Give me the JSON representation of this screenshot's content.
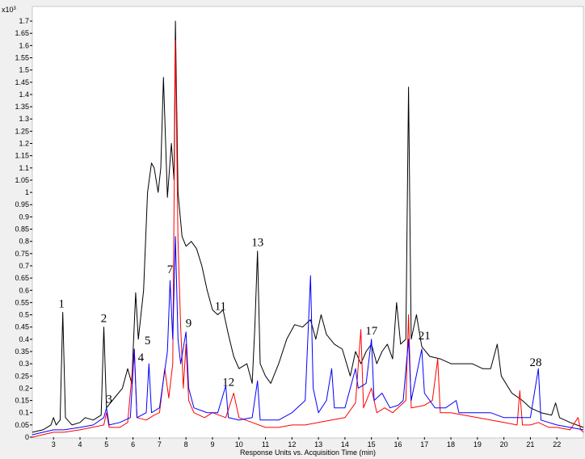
{
  "chart_data": {
    "type": "line",
    "title": "",
    "xlabel": "Response Units vs. Acquisition Time (min)",
    "ylabel": "",
    "y_multiplier": "x10",
    "y_multiplier_exp": "3",
    "xlim": [
      2.2,
      23.0
    ],
    "ylim": [
      0,
      1.72
    ],
    "x_ticks": [
      3,
      4,
      5,
      6,
      7,
      8,
      9,
      10,
      11,
      12,
      13,
      14,
      15,
      16,
      17,
      18,
      19,
      20,
      21,
      22
    ],
    "y_ticks": [
      0,
      0.05,
      0.1,
      0.15,
      0.2,
      0.25,
      0.3,
      0.35,
      0.4,
      0.45,
      0.5,
      0.55,
      0.6,
      0.65,
      0.7,
      0.75,
      0.8,
      0.85,
      0.9,
      0.95,
      1,
      1.05,
      1.1,
      1.15,
      1.2,
      1.25,
      1.3,
      1.35,
      1.4,
      1.45,
      1.5,
      1.55,
      1.6,
      1.65,
      1.7
    ],
    "grid": false,
    "series": [
      {
        "color": "#000000",
        "points": [
          [
            2.2,
            0.02
          ],
          [
            2.6,
            0.03
          ],
          [
            2.9,
            0.05
          ],
          [
            3.0,
            0.08
          ],
          [
            3.1,
            0.05
          ],
          [
            3.25,
            0.07
          ],
          [
            3.35,
            0.51
          ],
          [
            3.45,
            0.08
          ],
          [
            3.7,
            0.05
          ],
          [
            4.0,
            0.06
          ],
          [
            4.2,
            0.08
          ],
          [
            4.5,
            0.07
          ],
          [
            4.8,
            0.09
          ],
          [
            4.9,
            0.45
          ],
          [
            5.0,
            0.12
          ],
          [
            5.3,
            0.16
          ],
          [
            5.6,
            0.2
          ],
          [
            5.8,
            0.28
          ],
          [
            5.95,
            0.22
          ],
          [
            6.1,
            0.59
          ],
          [
            6.2,
            0.4
          ],
          [
            6.4,
            0.6
          ],
          [
            6.55,
            1.0
          ],
          [
            6.7,
            1.12
          ],
          [
            6.8,
            1.1
          ],
          [
            6.95,
            1.0
          ],
          [
            7.05,
            1.1
          ],
          [
            7.15,
            1.47
          ],
          [
            7.3,
            0.98
          ],
          [
            7.45,
            1.2
          ],
          [
            7.55,
            1.05
          ],
          [
            7.6,
            1.7
          ],
          [
            7.7,
            1.0
          ],
          [
            7.85,
            0.82
          ],
          [
            8.0,
            0.78
          ],
          [
            8.2,
            0.8
          ],
          [
            8.4,
            0.77
          ],
          [
            8.6,
            0.7
          ],
          [
            8.8,
            0.6
          ],
          [
            9.0,
            0.52
          ],
          [
            9.2,
            0.5
          ],
          [
            9.4,
            0.52
          ],
          [
            9.6,
            0.42
          ],
          [
            9.8,
            0.33
          ],
          [
            10.0,
            0.28
          ],
          [
            10.3,
            0.3
          ],
          [
            10.5,
            0.22
          ],
          [
            10.6,
            0.45
          ],
          [
            10.7,
            0.76
          ],
          [
            10.8,
            0.3
          ],
          [
            11.0,
            0.25
          ],
          [
            11.2,
            0.22
          ],
          [
            11.5,
            0.3
          ],
          [
            11.8,
            0.4
          ],
          [
            12.1,
            0.46
          ],
          [
            12.4,
            0.45
          ],
          [
            12.7,
            0.48
          ],
          [
            12.9,
            0.4
          ],
          [
            13.1,
            0.5
          ],
          [
            13.3,
            0.42
          ],
          [
            13.6,
            0.38
          ],
          [
            13.9,
            0.36
          ],
          [
            14.2,
            0.25
          ],
          [
            14.4,
            0.35
          ],
          [
            14.6,
            0.3
          ],
          [
            14.8,
            0.35
          ],
          [
            15.0,
            0.38
          ],
          [
            15.2,
            0.3
          ],
          [
            15.4,
            0.35
          ],
          [
            15.6,
            0.38
          ],
          [
            15.8,
            0.32
          ],
          [
            15.95,
            0.55
          ],
          [
            16.1,
            0.38
          ],
          [
            16.3,
            0.4
          ],
          [
            16.4,
            1.43
          ],
          [
            16.5,
            0.4
          ],
          [
            16.7,
            0.5
          ],
          [
            16.9,
            0.37
          ],
          [
            17.2,
            0.33
          ],
          [
            17.6,
            0.32
          ],
          [
            18.0,
            0.3
          ],
          [
            18.4,
            0.3
          ],
          [
            18.8,
            0.3
          ],
          [
            19.2,
            0.28
          ],
          [
            19.5,
            0.28
          ],
          [
            19.75,
            0.38
          ],
          [
            19.9,
            0.25
          ],
          [
            20.3,
            0.18
          ],
          [
            20.7,
            0.15
          ],
          [
            21.0,
            0.12
          ],
          [
            21.4,
            0.1
          ],
          [
            21.8,
            0.09
          ],
          [
            21.95,
            0.14
          ],
          [
            22.1,
            0.08
          ],
          [
            22.5,
            0.06
          ],
          [
            23.0,
            0.04
          ]
        ]
      },
      {
        "color": "#ff0000",
        "points": [
          [
            2.2,
            0.0
          ],
          [
            3.0,
            0.02
          ],
          [
            3.4,
            0.02
          ],
          [
            4.0,
            0.03
          ],
          [
            4.9,
            0.05
          ],
          [
            5.0,
            0.1
          ],
          [
            5.1,
            0.04
          ],
          [
            5.5,
            0.04
          ],
          [
            5.8,
            0.06
          ],
          [
            6.05,
            0.36
          ],
          [
            6.15,
            0.08
          ],
          [
            6.5,
            0.07
          ],
          [
            6.8,
            0.09
          ],
          [
            7.0,
            0.1
          ],
          [
            7.2,
            0.28
          ],
          [
            7.35,
            0.16
          ],
          [
            7.5,
            0.3
          ],
          [
            7.6,
            1.62
          ],
          [
            7.7,
            0.8
          ],
          [
            7.8,
            0.45
          ],
          [
            7.9,
            0.2
          ],
          [
            8.0,
            0.38
          ],
          [
            8.1,
            0.15
          ],
          [
            8.3,
            0.1
          ],
          [
            8.7,
            0.08
          ],
          [
            9.0,
            0.1
          ],
          [
            9.5,
            0.08
          ],
          [
            9.8,
            0.18
          ],
          [
            10.0,
            0.08
          ],
          [
            10.5,
            0.06
          ],
          [
            11.0,
            0.04
          ],
          [
            11.5,
            0.04
          ],
          [
            12.0,
            0.05
          ],
          [
            12.5,
            0.05
          ],
          [
            13.0,
            0.06
          ],
          [
            13.5,
            0.07
          ],
          [
            14.0,
            0.08
          ],
          [
            14.4,
            0.14
          ],
          [
            14.6,
            0.44
          ],
          [
            14.7,
            0.12
          ],
          [
            15.0,
            0.2
          ],
          [
            15.2,
            0.1
          ],
          [
            15.5,
            0.12
          ],
          [
            15.8,
            0.1
          ],
          [
            16.0,
            0.12
          ],
          [
            16.3,
            0.15
          ],
          [
            16.4,
            0.5
          ],
          [
            16.5,
            0.12
          ],
          [
            17.0,
            0.13
          ],
          [
            17.3,
            0.15
          ],
          [
            17.5,
            0.32
          ],
          [
            17.6,
            0.1
          ],
          [
            18.0,
            0.1
          ],
          [
            18.5,
            0.09
          ],
          [
            19.0,
            0.08
          ],
          [
            19.5,
            0.07
          ],
          [
            20.0,
            0.06
          ],
          [
            20.5,
            0.05
          ],
          [
            20.6,
            0.19
          ],
          [
            20.7,
            0.05
          ],
          [
            21.0,
            0.05
          ],
          [
            21.3,
            0.06
          ],
          [
            21.7,
            0.04
          ],
          [
            22.0,
            0.04
          ],
          [
            22.5,
            0.03
          ],
          [
            22.8,
            0.08
          ],
          [
            22.9,
            0.03
          ],
          [
            23.0,
            0.02
          ]
        ]
      },
      {
        "color": "#0000ff",
        "points": [
          [
            2.2,
            0.01
          ],
          [
            3.0,
            0.03
          ],
          [
            3.4,
            0.03
          ],
          [
            4.0,
            0.04
          ],
          [
            4.5,
            0.05
          ],
          [
            4.9,
            0.08
          ],
          [
            5.0,
            0.12
          ],
          [
            5.1,
            0.05
          ],
          [
            5.5,
            0.06
          ],
          [
            5.9,
            0.08
          ],
          [
            6.05,
            0.36
          ],
          [
            6.15,
            0.08
          ],
          [
            6.5,
            0.1
          ],
          [
            6.6,
            0.3
          ],
          [
            6.7,
            0.1
          ],
          [
            7.0,
            0.12
          ],
          [
            7.3,
            0.35
          ],
          [
            7.4,
            0.64
          ],
          [
            7.5,
            0.4
          ],
          [
            7.6,
            0.82
          ],
          [
            7.7,
            0.4
          ],
          [
            7.8,
            0.3
          ],
          [
            8.0,
            0.43
          ],
          [
            8.1,
            0.2
          ],
          [
            8.3,
            0.12
          ],
          [
            8.8,
            0.1
          ],
          [
            9.2,
            0.1
          ],
          [
            9.5,
            0.21
          ],
          [
            9.6,
            0.08
          ],
          [
            10.0,
            0.07
          ],
          [
            10.5,
            0.08
          ],
          [
            10.7,
            0.23
          ],
          [
            10.8,
            0.07
          ],
          [
            11.5,
            0.07
          ],
          [
            12.0,
            0.1
          ],
          [
            12.5,
            0.15
          ],
          [
            12.7,
            0.66
          ],
          [
            12.8,
            0.2
          ],
          [
            13.0,
            0.1
          ],
          [
            13.3,
            0.15
          ],
          [
            13.5,
            0.28
          ],
          [
            13.6,
            0.12
          ],
          [
            14.0,
            0.12
          ],
          [
            14.4,
            0.28
          ],
          [
            14.5,
            0.2
          ],
          [
            14.8,
            0.22
          ],
          [
            15.0,
            0.4
          ],
          [
            15.1,
            0.15
          ],
          [
            15.4,
            0.18
          ],
          [
            15.7,
            0.12
          ],
          [
            16.0,
            0.13
          ],
          [
            16.2,
            0.15
          ],
          [
            16.4,
            0.4
          ],
          [
            16.5,
            0.15
          ],
          [
            16.9,
            0.36
          ],
          [
            17.0,
            0.18
          ],
          [
            17.4,
            0.12
          ],
          [
            17.8,
            0.12
          ],
          [
            18.2,
            0.15
          ],
          [
            18.3,
            0.1
          ],
          [
            18.8,
            0.1
          ],
          [
            19.5,
            0.1
          ],
          [
            20.0,
            0.08
          ],
          [
            20.5,
            0.08
          ],
          [
            21.0,
            0.08
          ],
          [
            21.3,
            0.28
          ],
          [
            21.4,
            0.07
          ],
          [
            22.0,
            0.05
          ],
          [
            22.5,
            0.04
          ],
          [
            23.0,
            0.03
          ]
        ]
      }
    ],
    "annotations": [
      {
        "text": "1",
        "x": 3.3,
        "y": 0.53
      },
      {
        "text": "2",
        "x": 4.9,
        "y": 0.47
      },
      {
        "text": "3",
        "x": 5.1,
        "y": 0.14
      },
      {
        "text": "4",
        "x": 6.3,
        "y": 0.31
      },
      {
        "text": "5",
        "x": 6.55,
        "y": 0.38
      },
      {
        "text": "7",
        "x": 7.4,
        "y": 0.67
      },
      {
        "text": "9",
        "x": 8.1,
        "y": 0.45
      },
      {
        "text": "11",
        "x": 9.3,
        "y": 0.52
      },
      {
        "text": "12",
        "x": 9.6,
        "y": 0.21
      },
      {
        "text": "13",
        "x": 10.7,
        "y": 0.78
      },
      {
        "text": "17",
        "x": 15.0,
        "y": 0.42
      },
      {
        "text": "21",
        "x": 17.0,
        "y": 0.4
      },
      {
        "text": "28",
        "x": 21.2,
        "y": 0.29
      }
    ]
  }
}
